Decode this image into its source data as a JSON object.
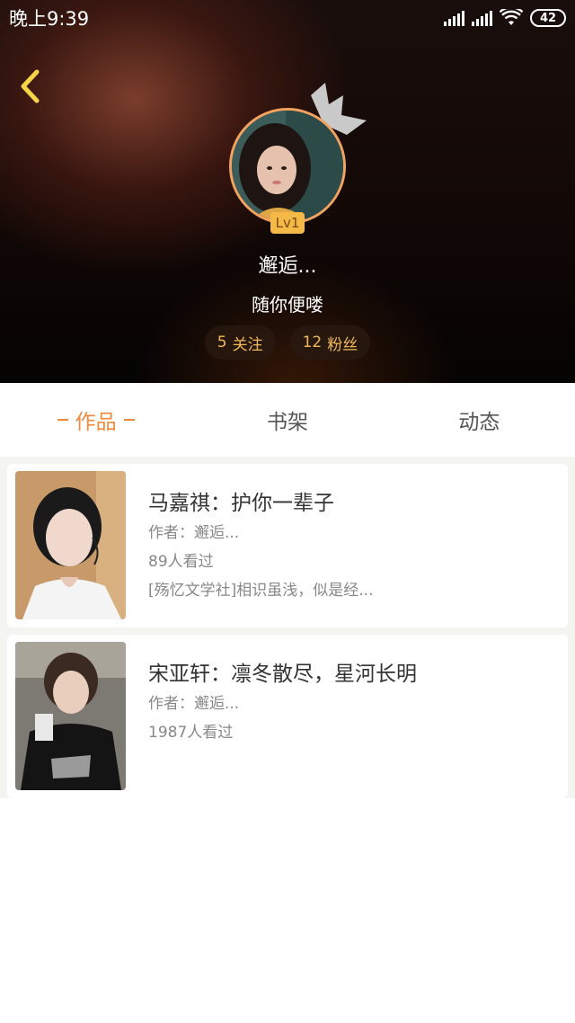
{
  "status_bar": {
    "time": "晚上9:39",
    "battery": "42"
  },
  "profile": {
    "level": "Lv1",
    "username": "邂逅...",
    "bio": "随你便喽",
    "following_count": "5",
    "following_label": "关注",
    "followers_count": "12",
    "followers_label": "粉丝"
  },
  "tabs": [
    {
      "label": "作品",
      "active": true
    },
    {
      "label": "书架",
      "active": false
    },
    {
      "label": "动态",
      "active": false
    }
  ],
  "works": [
    {
      "title": "马嘉祺：护你一辈子",
      "author": "作者：邂逅...",
      "views": "89人看过",
      "summary": "[殇忆文学社]相识虽浅，似是经..."
    },
    {
      "title": "宋亚轩：凛冬散尽，星河长明",
      "author": "作者：邂逅...",
      "views": "1987人看过",
      "summary": ""
    }
  ],
  "colors": {
    "accent": "#f08a3c",
    "badge": "#f5b947",
    "pill_text": "#f0b85a"
  }
}
